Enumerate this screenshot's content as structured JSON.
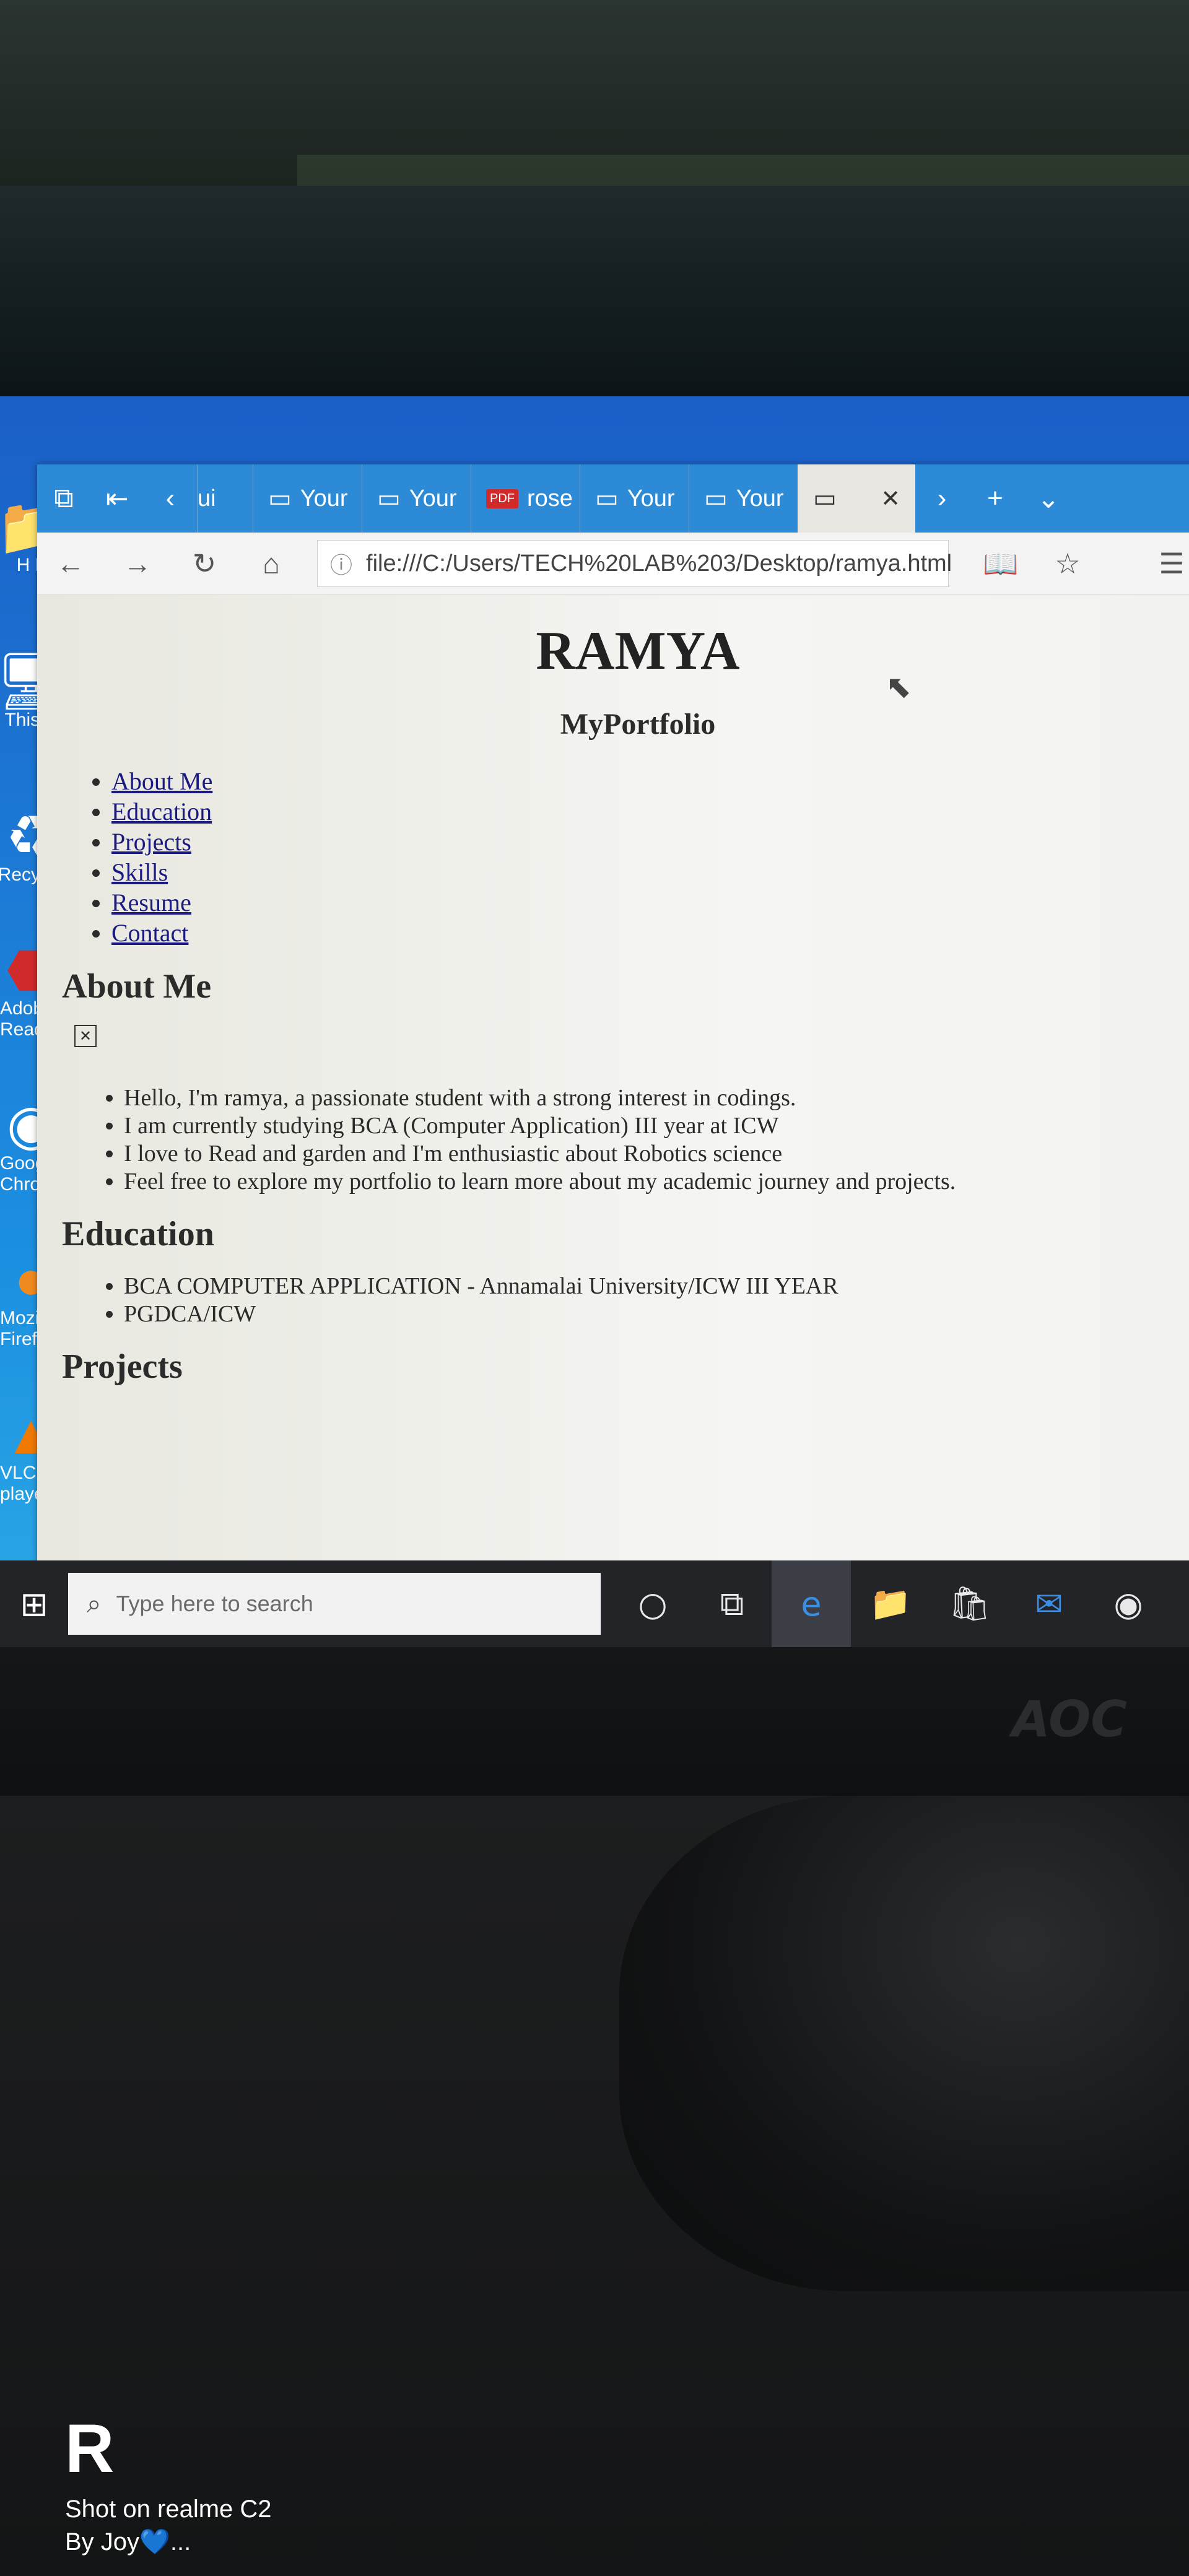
{
  "browser": {
    "tabs": [
      {
        "icon": "tab-page-icon",
        "label": "ui"
      },
      {
        "icon": "tab-page-icon",
        "label": "Your"
      },
      {
        "icon": "tab-page-icon",
        "label": "Your"
      },
      {
        "icon": "pdf-icon",
        "label": "rose",
        "badge": "PDF"
      },
      {
        "icon": "tab-page-icon",
        "label": "Your"
      },
      {
        "icon": "tab-page-icon",
        "label": "Your"
      }
    ],
    "url": "file:///C:/Users/TECH%20LAB%203/Desktop/ramya.html"
  },
  "page": {
    "title": "RAMYA",
    "subtitle": "MyPortfolio",
    "nav": [
      "About Me",
      "Education",
      "Projects",
      "Skills",
      "Resume",
      "Contact"
    ],
    "about_heading": "About Me",
    "about_items": [
      "Hello, I'm ramya, a passionate student with a strong interest in codings.",
      "I am currently studying BCA (Computer Application) III year at ICW",
      "I love to Read and garden and I'm enthusiastic about Robotics science",
      "Feel free to explore my portfolio to learn more about my academic journey and projects."
    ],
    "education_heading": "Education",
    "education_items": [
      "BCA COMPUTER APPLICATION - Annamalai University/ICW III YEAR",
      "PGDCA/ICW"
    ],
    "projects_heading": "Projects"
  },
  "desktop": {
    "icons": [
      "H L",
      "This P",
      "Recycle",
      "Adob Reade",
      "Goog Chrom",
      "Mozi Firef",
      "VLC m player"
    ]
  },
  "taskbar": {
    "search_placeholder": "Type here to search"
  },
  "monitor": {
    "brand": "AOC"
  },
  "watermark": {
    "logo": "R",
    "line1": "Shot on realme C2",
    "line2": "By Joy💙..."
  }
}
